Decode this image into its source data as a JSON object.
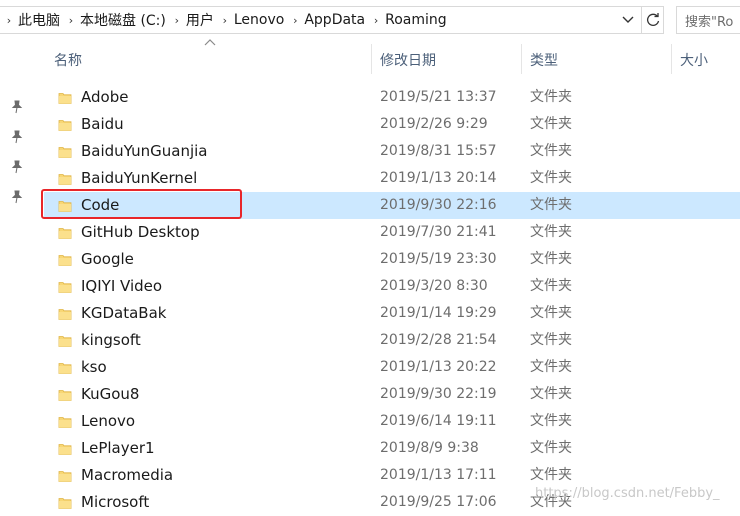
{
  "address": {
    "crumbs": [
      "此电脑",
      "本地磁盘 (C:)",
      "用户",
      "Lenovo",
      "AppData",
      "Roaming"
    ]
  },
  "search": {
    "placeholder": "搜索\"Ro"
  },
  "columns": {
    "name": "名称",
    "date": "修改日期",
    "type": "类型",
    "size": "大小"
  },
  "files": [
    {
      "name": "Adobe",
      "date": "2019/5/21 13:37",
      "type": "文件夹"
    },
    {
      "name": "Baidu",
      "date": "2019/2/26 9:29",
      "type": "文件夹"
    },
    {
      "name": "BaiduYunGuanjia",
      "date": "2019/8/31 15:57",
      "type": "文件夹"
    },
    {
      "name": "BaiduYunKernel",
      "date": "2019/1/13 20:14",
      "type": "文件夹"
    },
    {
      "name": "Code",
      "date": "2019/9/30 22:16",
      "type": "文件夹"
    },
    {
      "name": "GitHub Desktop",
      "date": "2019/7/30 21:41",
      "type": "文件夹"
    },
    {
      "name": "Google",
      "date": "2019/5/19 23:30",
      "type": "文件夹"
    },
    {
      "name": "IQIYI Video",
      "date": "2019/3/20 8:30",
      "type": "文件夹"
    },
    {
      "name": "KGDataBak",
      "date": "2019/1/14 19:29",
      "type": "文件夹"
    },
    {
      "name": "kingsoft",
      "date": "2019/2/28 21:54",
      "type": "文件夹"
    },
    {
      "name": "kso",
      "date": "2019/1/13 20:22",
      "type": "文件夹"
    },
    {
      "name": "KuGou8",
      "date": "2019/9/30 22:19",
      "type": "文件夹"
    },
    {
      "name": "Lenovo",
      "date": "2019/6/14 19:11",
      "type": "文件夹"
    },
    {
      "name": "LePlayer1",
      "date": "2019/8/9 9:38",
      "type": "文件夹"
    },
    {
      "name": "Macromedia",
      "date": "2019/1/13 17:11",
      "type": "文件夹"
    },
    {
      "name": "Microsoft",
      "date": "2019/9/25 17:06",
      "type": "文件夹"
    }
  ],
  "selected_file": "Code",
  "watermark": "https://blog.csdn.net/Febby_",
  "colors": {
    "selection": "#cce8ff",
    "annotation": "#e8262a",
    "folder": "#f8d775"
  }
}
